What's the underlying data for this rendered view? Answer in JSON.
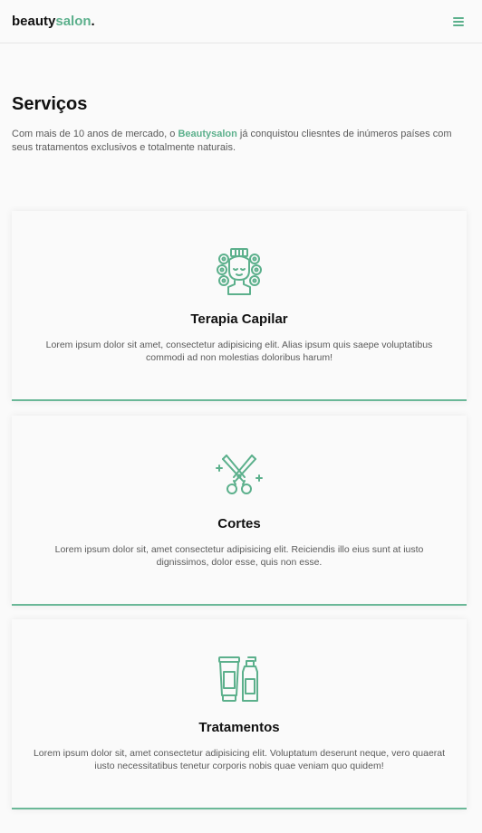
{
  "header": {
    "logo_part1": "beauty",
    "logo_part2": "salon",
    "logo_dot": "."
  },
  "services": {
    "title": "Serviços",
    "intro_before": "Com mais de 10 anos de mercado, o ",
    "intro_brand": "Beautysalon",
    "intro_after": " já conquistou cliesntes de inúmeros países com seus tratamentos exclusivos e totalmente naturais.",
    "cards": [
      {
        "icon": "hair-rollers-icon",
        "title": "Terapia Capilar",
        "text": "Lorem ipsum dolor sit amet, consectetur adipisicing elit. Alias ipsum quis saepe voluptatibus commodi ad non molestias doloribus harum!"
      },
      {
        "icon": "scissors-icon",
        "title": "Cortes",
        "text": "Lorem ipsum dolor sit, amet consectetur adipisicing elit. Reiciendis illo eius sunt at iusto dignissimos, dolor esse, quis non esse."
      },
      {
        "icon": "cosmetic-bottles-icon",
        "title": "Tratamentos",
        "text": "Lorem ipsum dolor sit, amet consectetur adipisicing elit. Voluptatum deserunt neque, vero quaerat iusto necessitatibus tenetur corporis nobis quae veniam quo quidem!"
      }
    ]
  },
  "colors": {
    "accent": "#5cb08c",
    "card_border": "#6bb898",
    "background": "#fafafa"
  }
}
